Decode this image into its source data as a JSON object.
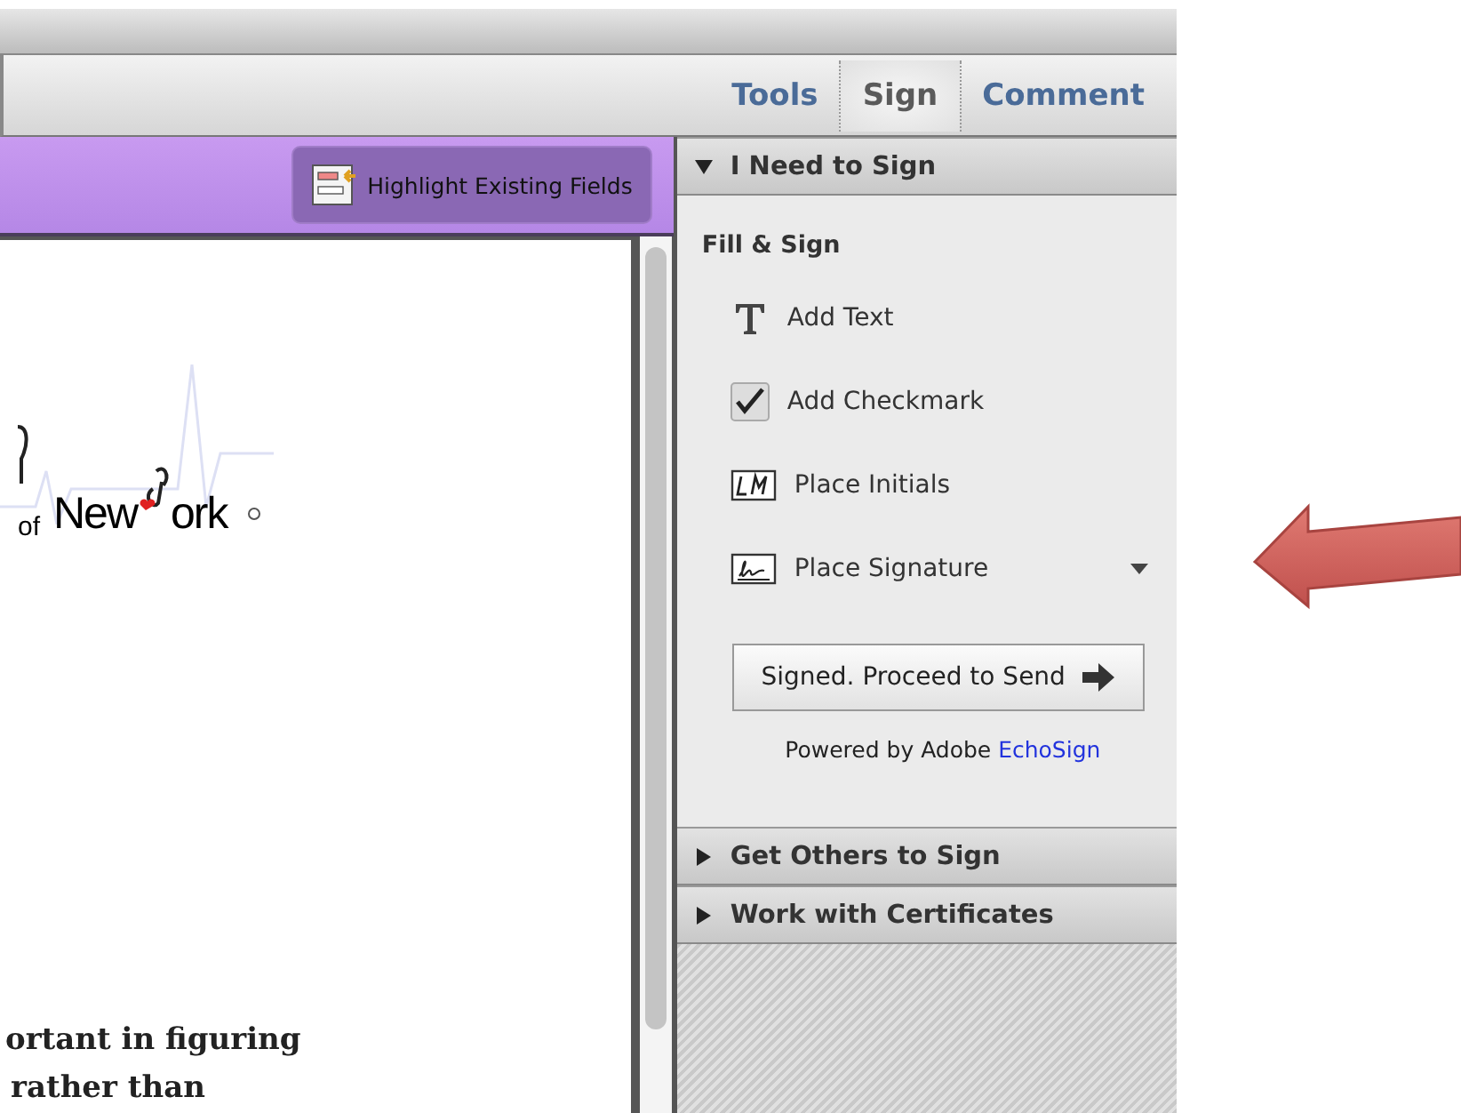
{
  "toolbar": {
    "tabs": [
      {
        "label": "Tools",
        "selected": false
      },
      {
        "label": "Sign",
        "selected": true
      },
      {
        "label": "Comment",
        "selected": false
      }
    ]
  },
  "highlight_button": {
    "label": "Highlight Existing Fields"
  },
  "document": {
    "logo": {
      "small": "of",
      "before": "New",
      "after": "ork"
    },
    "lines": [
      "ortant in figuring",
      "rather than"
    ]
  },
  "panel": {
    "sections": [
      {
        "title": "I Need to Sign",
        "expanded": true,
        "heading": "Fill & Sign",
        "items": [
          {
            "kind": "text",
            "label": "Add Text"
          },
          {
            "kind": "checkmark",
            "label": "Add Checkmark"
          },
          {
            "kind": "initials",
            "label": "Place Initials"
          },
          {
            "kind": "signature",
            "label": "Place Signature"
          }
        ],
        "button": "Signed. Proceed to Send",
        "powered": "Powered by Adobe",
        "powered_link": "EchoSign"
      },
      {
        "title": "Get Others to Sign",
        "expanded": false
      },
      {
        "title": "Work with Certificates",
        "expanded": false
      }
    ]
  }
}
